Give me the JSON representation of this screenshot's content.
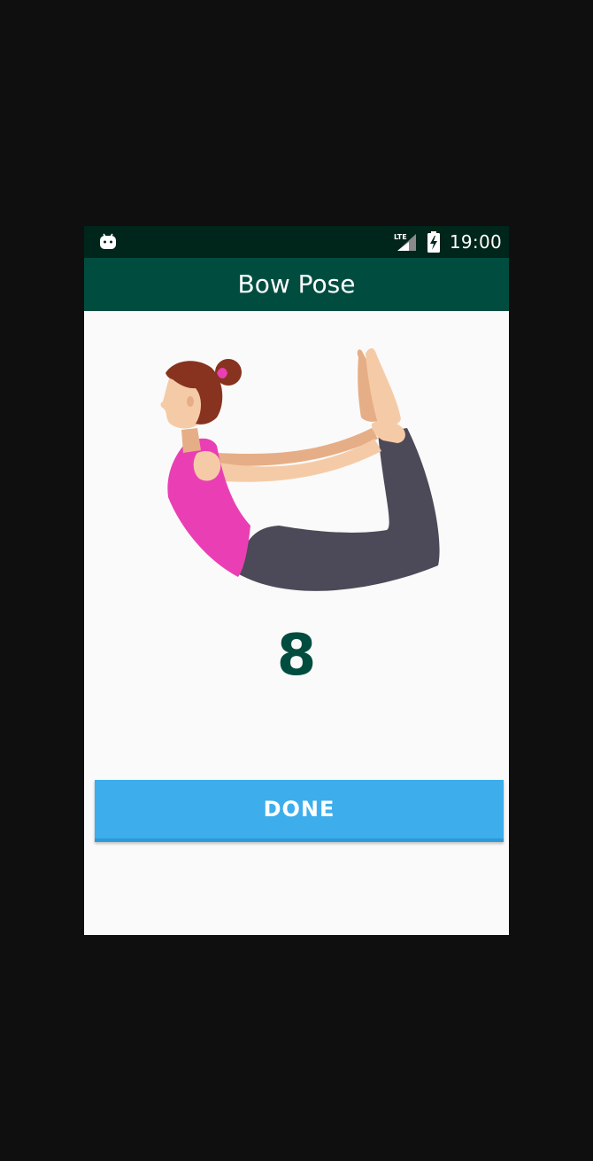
{
  "status_bar": {
    "time": "19:00",
    "icons": [
      "android-debug-icon",
      "lte-signal-icon",
      "battery-charging-icon"
    ]
  },
  "app_bar": {
    "title": "Bow Pose"
  },
  "exercise": {
    "illustration": "bow-pose-illustration",
    "count": "8"
  },
  "actions": {
    "done_label": "DONE"
  },
  "colors": {
    "status_bar": "#00251a",
    "app_bar": "#004d40",
    "counter": "#004d40",
    "button": "#3daeeb",
    "background": "#fafafa",
    "outer_background": "#0f0f0f"
  }
}
